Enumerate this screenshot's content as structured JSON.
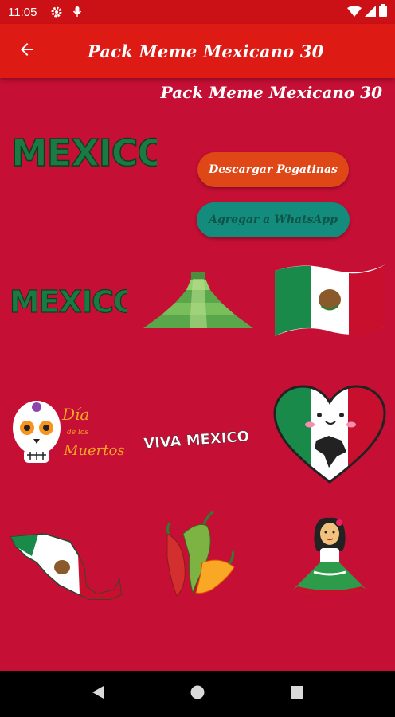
{
  "status_bar": {
    "time": "11:05",
    "icons": [
      "settings-icon",
      "mic-icon",
      "wifi-icon",
      "signal-icon",
      "battery-icon"
    ]
  },
  "app_bar": {
    "title": "Pack Meme Mexicano 30",
    "back_icon": "arrow-left-icon"
  },
  "pack": {
    "title": "Pack Meme Mexicano 30",
    "tray_icon_text": "MEXICO"
  },
  "buttons": {
    "download": "Descargar Pegatinas",
    "whatsapp": "Agregar a WhatsApp"
  },
  "stickers": [
    {
      "name": "mexico-text-sticker",
      "text": "MEXICO"
    },
    {
      "name": "pyramid-sticker"
    },
    {
      "name": "flag-sticker"
    },
    {
      "name": "dia-de-los-muertos-sticker",
      "lines": [
        "Día",
        "de los",
        "Muertos"
      ]
    },
    {
      "name": "viva-mexico-sticker",
      "text": "VIVA MEXICO"
    },
    {
      "name": "heart-flag-sticker"
    },
    {
      "name": "map-sticker"
    },
    {
      "name": "chili-sticker"
    },
    {
      "name": "dancer-sticker"
    }
  ],
  "colors": {
    "background": "#c50f35",
    "app_bar": "#dd1a14",
    "download_button": "#e04717",
    "whatsapp_button": "#138c7d",
    "mexico_green": "#1a8a4a",
    "mexico_red": "#c8102e"
  },
  "nav_bar": {
    "icons": [
      "back-triangle-icon",
      "home-circle-icon",
      "recents-square-icon"
    ]
  }
}
